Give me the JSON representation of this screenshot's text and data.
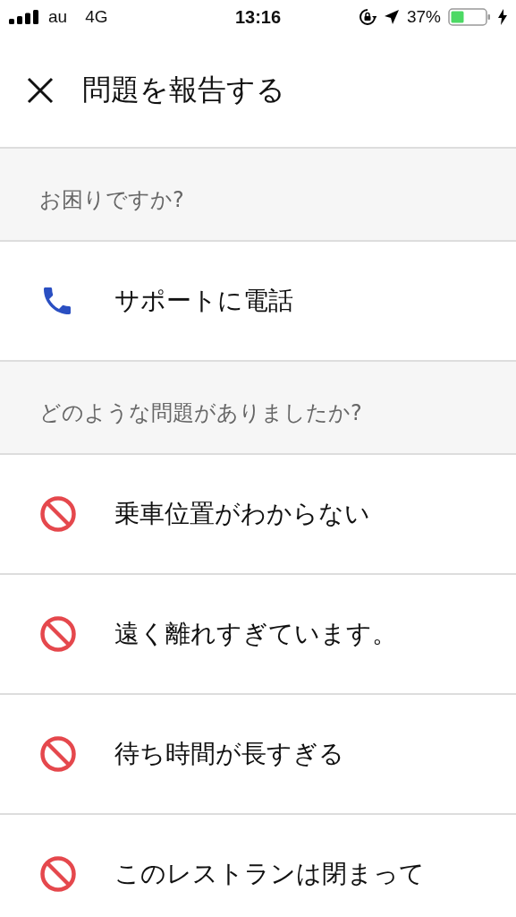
{
  "status_bar": {
    "carrier": "au",
    "network": "4G",
    "time": "13:16",
    "battery": "37%"
  },
  "header": {
    "title": "問題を報告する"
  },
  "sections": [
    {
      "title": "お困りですか?",
      "items": [
        {
          "kind": "phone",
          "label": "サポートに電話"
        }
      ]
    },
    {
      "title": "どのような問題がありましたか?",
      "items": [
        {
          "kind": "blocked",
          "label": "乗車位置がわからない"
        },
        {
          "kind": "blocked",
          "label": "遠く離れすぎています。"
        },
        {
          "kind": "blocked",
          "label": "待ち時間が長すぎる"
        },
        {
          "kind": "blocked",
          "label": "このレストランは閉まって"
        }
      ]
    }
  ]
}
